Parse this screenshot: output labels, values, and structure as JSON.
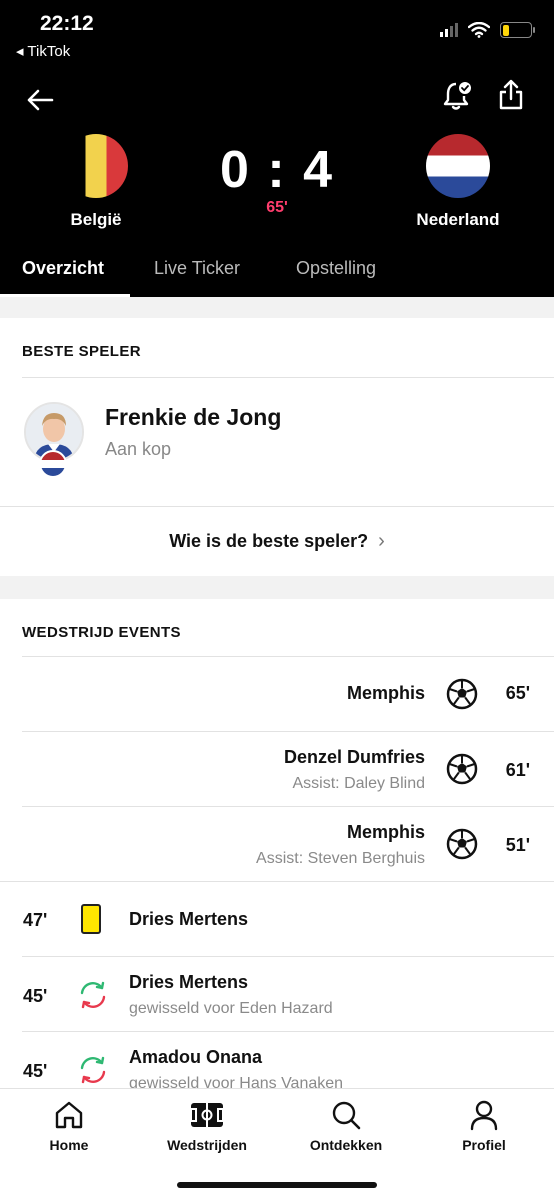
{
  "status_bar": {
    "time": "22:12",
    "back_app": "◂ TikTok",
    "battery_level": 0.25
  },
  "match": {
    "home_team": "België",
    "away_team": "Nederland",
    "score": "0 : 4",
    "minute": "65'",
    "home_flag": "belgium-flag",
    "away_flag": "netherlands-flag"
  },
  "toolbar": {
    "back_icon": "arrow-left-icon",
    "bell_icon": "bell-check-icon",
    "share_icon": "share-icon"
  },
  "tabs": [
    {
      "label": "Overzicht",
      "active": true
    },
    {
      "label": "Live Ticker",
      "active": false
    },
    {
      "label": "Opstelling",
      "active": false
    }
  ],
  "best_player": {
    "section_title": "BESTE SPELER",
    "name": "Frenkie de Jong",
    "subtitle": "Aan kop",
    "vote_label": "Wie is de beste speler?"
  },
  "events": {
    "section_title": "WEDSTRIJD EVENTS",
    "items": [
      {
        "side": "right",
        "type": "goal",
        "player": "Memphis",
        "detail": "",
        "minute": "65'"
      },
      {
        "side": "right",
        "type": "goal",
        "player": "Denzel Dumfries",
        "detail": "Assist: Daley Blind",
        "minute": "61'"
      },
      {
        "side": "right",
        "type": "goal",
        "player": "Memphis",
        "detail": "Assist: Steven Berghuis",
        "minute": "51'"
      },
      {
        "side": "left",
        "type": "yellow-card",
        "player": "Dries Mertens",
        "detail": "",
        "minute": "47'"
      },
      {
        "side": "left",
        "type": "substitution",
        "player": "Dries Mertens",
        "detail": "gewisseld voor Eden Hazard",
        "minute": "45'"
      },
      {
        "side": "left",
        "type": "substitution",
        "player": "Amadou Onana",
        "detail": "gewisseld voor Hans Vanaken",
        "minute": "45'"
      }
    ]
  },
  "bottom_nav": [
    {
      "label": "Home",
      "icon": "home-icon"
    },
    {
      "label": "Wedstrijden",
      "icon": "pitch-icon"
    },
    {
      "label": "Ontdekken",
      "icon": "search-icon"
    },
    {
      "label": "Profiel",
      "icon": "user-icon"
    }
  ],
  "colors": {
    "header_bg": "#000000",
    "accent_minute": "#ff3d6d",
    "yellow_card": "#ffe600",
    "sub_in": "#2eb872",
    "sub_out": "#e8394d"
  }
}
